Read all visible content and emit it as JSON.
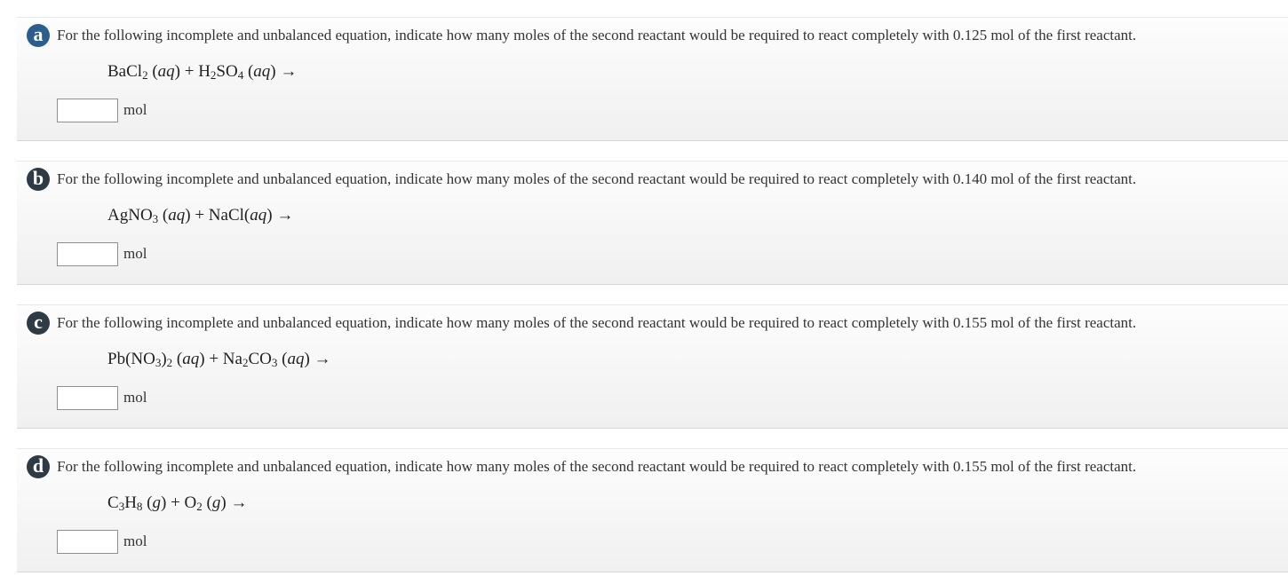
{
  "questions": [
    {
      "letter": "a",
      "prompt": "For the following incomplete and unbalanced equation, indicate how many moles of the second reactant would be required to react completely with 0.125 mol of the first reactant.",
      "unit": "mol",
      "answer_value": ""
    },
    {
      "letter": "b",
      "prompt": "For the following incomplete and unbalanced equation, indicate how many moles of the second reactant would be required to react completely with 0.140 mol of the first reactant.",
      "unit": "mol",
      "answer_value": ""
    },
    {
      "letter": "c",
      "prompt": "For the following incomplete and unbalanced equation, indicate how many moles of the second reactant would be required to react completely with 0.155 mol of the first reactant.",
      "unit": "mol",
      "answer_value": ""
    },
    {
      "letter": "d",
      "prompt": "For the following incomplete and unbalanced equation, indicate how many moles of the second reactant would be required to react completely with 0.155 mol of the first reactant.",
      "unit": "mol",
      "answer_value": ""
    }
  ],
  "equations": {
    "a": {
      "r1": "BaCl",
      "r1_sub": "2",
      "state1": "aq",
      "plus": "+",
      "r2a": "H",
      "r2a_sub": "2",
      "r2b": "SO",
      "r2b_sub": "4",
      "state2": "aq",
      "arrow": "→"
    },
    "b": {
      "r1": "AgNO",
      "r1_sub": "3",
      "state1": "aq",
      "plus": "+",
      "r2": "NaCl",
      "state2": "aq",
      "arrow": "→"
    },
    "c": {
      "r1a": "Pb(NO",
      "r1a_sub": "3",
      "r1b": ")",
      "r1b_sub": "2",
      "state1": "aq",
      "plus": "+",
      "r2a": "Na",
      "r2a_sub": "2",
      "r2b": "CO",
      "r2b_sub": "3",
      "state2": "aq",
      "arrow": "→"
    },
    "d": {
      "r1a": "C",
      "r1a_sub": "3",
      "r1b": "H",
      "r1b_sub": "8",
      "state1": "g",
      "plus": "+",
      "r2": "O",
      "r2_sub": "2",
      "state2": "g",
      "arrow": "→"
    }
  },
  "colors": {
    "badge_a": "#2c5d8f",
    "badge_b": "#2f3b44",
    "badge_c": "#2f3b44",
    "badge_d": "#2f3b44"
  }
}
